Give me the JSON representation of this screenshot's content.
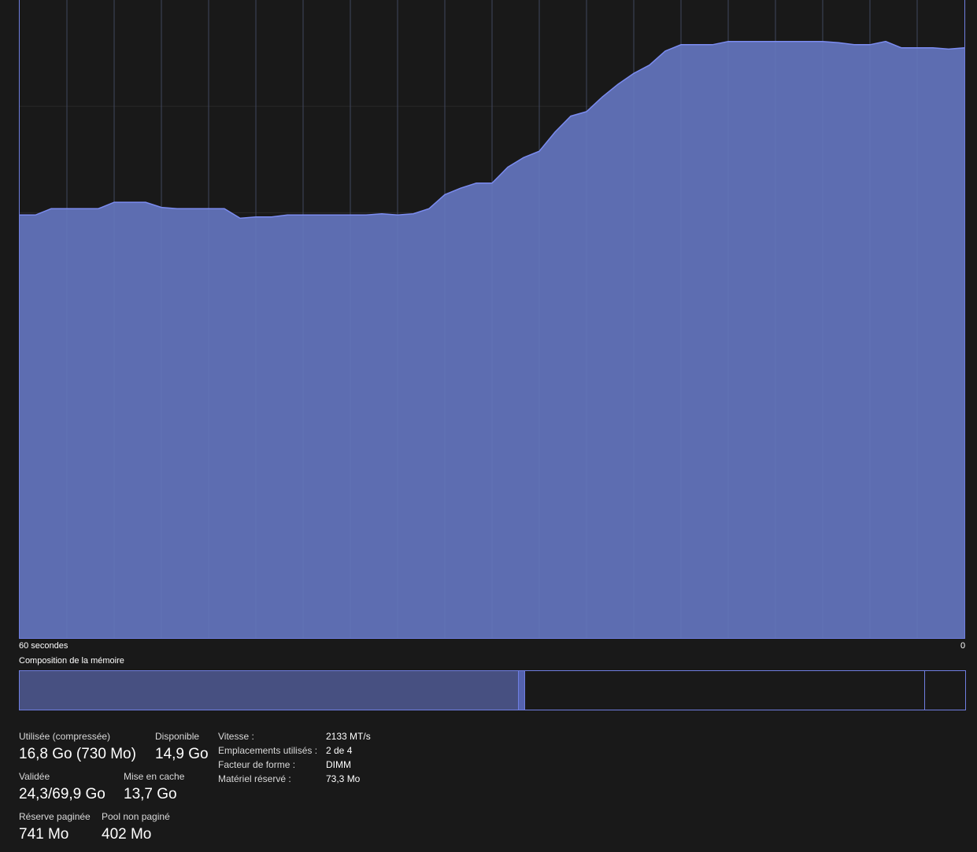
{
  "colors": {
    "background": "#191919",
    "graph_fill": "#5f6fb5",
    "graph_line": "#7b8cf0",
    "graph_border": "#6f7ee0",
    "grid": "#2a2a2a",
    "composition_used": "#475081",
    "composition_modified": "#5462ae"
  },
  "chart_data": {
    "type": "area",
    "x_start_label": "60 secondes",
    "x_end_label": "0",
    "x": [
      60,
      59,
      58,
      57,
      56,
      55,
      54,
      53,
      52,
      51,
      50,
      49,
      48,
      47,
      46,
      45,
      44,
      43,
      42,
      41,
      40,
      39,
      38,
      37,
      36,
      35,
      34,
      33,
      32,
      31,
      30,
      29,
      28,
      27,
      26,
      25,
      24,
      23,
      22,
      21,
      20,
      19,
      18,
      17,
      16,
      15,
      14,
      13,
      12,
      11,
      10,
      9,
      8,
      7,
      6,
      5,
      4,
      3,
      2,
      1,
      0
    ],
    "values": [
      66.3,
      66.3,
      67.3,
      67.3,
      67.3,
      67.3,
      68.3,
      68.3,
      68.3,
      67.5,
      67.3,
      67.3,
      67.3,
      67.3,
      65.8,
      66.0,
      66.0,
      66.3,
      66.3,
      66.3,
      66.3,
      66.3,
      66.3,
      66.5,
      66.3,
      66.5,
      67.3,
      69.5,
      70.5,
      71.3,
      71.3,
      73.8,
      75.3,
      76.3,
      79.3,
      81.8,
      82.5,
      84.8,
      86.8,
      88.5,
      89.8,
      92.0,
      93.0,
      93.0,
      93.0,
      93.5,
      93.5,
      93.5,
      93.5,
      93.5,
      93.5,
      93.5,
      93.3,
      93.0,
      93.0,
      93.5,
      92.5,
      92.5,
      92.5,
      92.3,
      92.5
    ],
    "ylim": [
      0,
      100
    ],
    "grid": true,
    "grid_columns": 20,
    "grid_rows": 6
  },
  "graph": {
    "time_start": "60 secondes",
    "time_end": "0"
  },
  "composition": {
    "title": "Composition de la mémoire",
    "segments": [
      {
        "name": "used",
        "fraction": 0.527
      },
      {
        "name": "modified",
        "fraction": 0.0075
      },
      {
        "name": "standby",
        "fraction": 0.4225
      },
      {
        "name": "free",
        "fraction": 0.043
      }
    ]
  },
  "stats": {
    "used_label": "Utilisée (compressée)",
    "used_value": "16,8 Go (730 Mo)",
    "available_label": "Disponible",
    "available_value": "14,9 Go",
    "committed_label": "Validée",
    "committed_value": "24,3/69,9 Go",
    "cached_label": "Mise en cache",
    "cached_value": "13,7 Go",
    "paged_label": "Réserve paginée",
    "paged_value": "741 Mo",
    "nonpaged_label": "Pool non paginé",
    "nonpaged_value": "402 Mo"
  },
  "specs": {
    "speed_label": "Vitesse :",
    "speed_value": "2133 MT/s",
    "slots_label": "Emplacements utilisés :",
    "slots_value": "2 de 4",
    "form_label": "Facteur de forme :",
    "form_value": "DIMM",
    "reserved_label": "Matériel réservé :",
    "reserved_value": "73,3 Mo"
  }
}
